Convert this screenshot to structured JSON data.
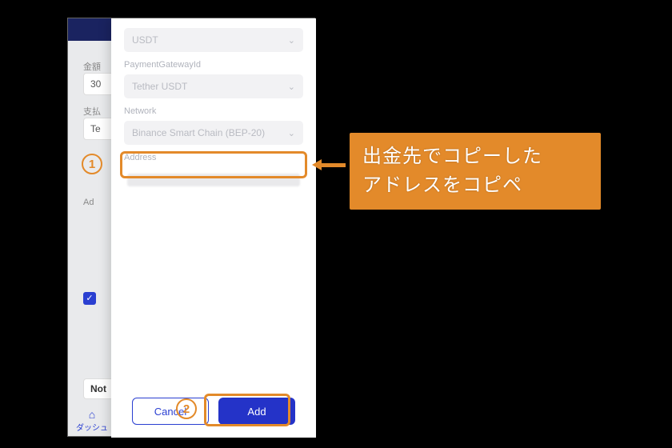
{
  "modal": {
    "currency_select": {
      "value": "USDT"
    },
    "gateway_label": "PaymentGatewayId",
    "gateway_select": {
      "value": "Tether USDT"
    },
    "network_label": "Network",
    "network_select": {
      "value": "Binance Smart Chain (BEP-20)"
    },
    "address_label": "Address",
    "cancel_label": "Cancel",
    "add_label": "Add"
  },
  "background": {
    "amount_label": "金額",
    "amount_value": "30",
    "pay_label": "支払",
    "pay_value": "Te",
    "addr_label": "Ad",
    "note_label": "Not",
    "nav_label": "ダッシュ"
  },
  "annotation": {
    "marker1": "1",
    "marker2": "2",
    "callout_line1": "出金先でコピーした",
    "callout_line2": "アドレスをコピペ"
  }
}
